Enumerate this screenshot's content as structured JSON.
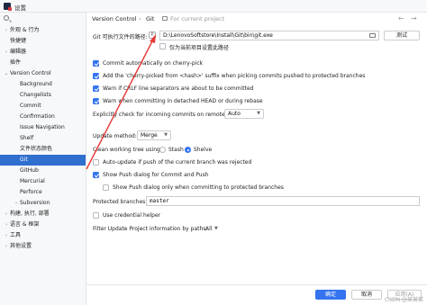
{
  "window": {
    "title": "设置"
  },
  "sidebar": {
    "items": [
      {
        "label": "外观 & 行为",
        "chevron": "›"
      },
      {
        "label": "快捷键",
        "chevron": ""
      },
      {
        "label": "编辑器",
        "chevron": "›"
      },
      {
        "label": "插件",
        "chevron": ""
      },
      {
        "label": "Version Control",
        "chevron": "⌄"
      },
      {
        "label": "Background",
        "chevron": ""
      },
      {
        "label": "Changelists",
        "chevron": ""
      },
      {
        "label": "Commit",
        "chevron": ""
      },
      {
        "label": "Confirmation",
        "chevron": ""
      },
      {
        "label": "Issue Navigation",
        "chevron": ""
      },
      {
        "label": "Shelf",
        "chevron": ""
      },
      {
        "label": "文件状态颜色",
        "chevron": ""
      },
      {
        "label": "Git",
        "chevron": ""
      },
      {
        "label": "GitHub",
        "chevron": ""
      },
      {
        "label": "Mercurial",
        "chevron": ""
      },
      {
        "label": "Perforce",
        "chevron": ""
      },
      {
        "label": "Subversion",
        "chevron": "›"
      },
      {
        "label": "构建, 执行, 部署",
        "chevron": "›"
      },
      {
        "label": "语言 & 框架",
        "chevron": "›"
      },
      {
        "label": "工具",
        "chevron": "›"
      },
      {
        "label": "其他设置",
        "chevron": "›"
      }
    ],
    "selected": "Git"
  },
  "header": {
    "crumb_parent": "Version Control",
    "crumb_sep": "›",
    "crumb_current": "Git",
    "scope_text": "For current project",
    "back_arrow": "←",
    "forward_arrow": "→"
  },
  "git": {
    "path_label": "Git 可执行文件的路径:",
    "path_value": "D:\\LenovoSoftstore\\Install\\Git\\bin\\git.exe",
    "test_button": "测试",
    "project_only_label": "仅为当前项目设置此路径",
    "opt_commit_auto": "Commit automatically on cherry-pick",
    "opt_cherry_suffix": "Add the 'cherry-picked from <hash>' suffix when picking commits pushed to protected branches",
    "opt_crlf": "Warn if CRLF line separators are about to be committed",
    "opt_detached": "Warn when committing in detached HEAD or during rebase",
    "incoming_label": "Explicitly check for incoming commits on remotes:",
    "incoming_value": "Auto",
    "update_method_label": "Update method:",
    "update_method_value": "Merge",
    "clean_tree_label": "Clean working tree using:",
    "radio_stash": "Stash",
    "radio_shelve": "Shelve",
    "opt_autoupdate": "Auto-update if push of the current branch was rejected",
    "opt_show_push": "Show Push dialog for Commit and Push",
    "opt_show_push_protected": "Show Push dialog only when committing to protected branches",
    "protected_label": "Protected branches:",
    "protected_value": "master",
    "opt_credential": "Use credential helper",
    "filter_label": "Filter Update Project information by paths:",
    "filter_value": "All"
  },
  "footer": {
    "ok": "确定",
    "cancel": "取消",
    "apply": "应用(A)"
  },
  "watermark": "CSDN @某某某",
  "annotation_color": "#e53935"
}
